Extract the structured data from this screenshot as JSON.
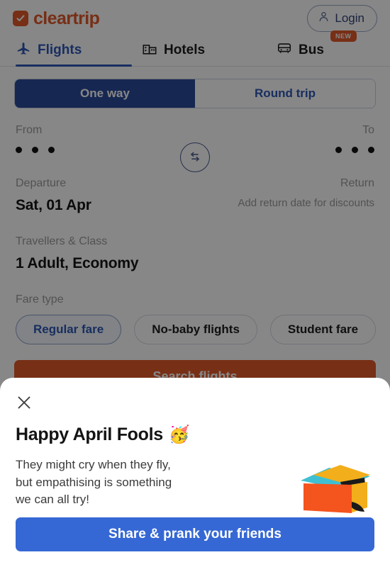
{
  "header": {
    "brand_name": "cleartrip",
    "brand_icon": "check-badge-icon",
    "login_label": "Login",
    "login_icon": "person-icon"
  },
  "tabs": [
    {
      "label": "Flights",
      "icon": "airplane-icon",
      "active": true
    },
    {
      "label": "Hotels",
      "icon": "hotel-building-icon",
      "active": false
    },
    {
      "label": "Bus",
      "icon": "bus-icon",
      "active": false,
      "badge": "NEW"
    }
  ],
  "trip_toggle": {
    "options": [
      "One way",
      "Round trip"
    ],
    "selected": "One way"
  },
  "route": {
    "from_label": "From",
    "to_label": "To",
    "from_value": "",
    "to_value": "",
    "loading": true,
    "swap_icon": "swap-arrows-icon"
  },
  "dates": {
    "departure_label": "Departure",
    "departure_value": "Sat, 01 Apr",
    "return_label": "Return",
    "return_hint": "Add return date for discounts"
  },
  "travellers": {
    "label": "Travellers & Class",
    "value": "1 Adult, Economy"
  },
  "fare": {
    "label": "Fare type",
    "chips": [
      {
        "label": "Regular fare",
        "selected": true
      },
      {
        "label": "No-baby flights",
        "selected": false
      },
      {
        "label": "Student fare",
        "selected": false
      }
    ]
  },
  "search": {
    "label": "Search flights"
  },
  "modal": {
    "close_icon": "close-icon",
    "title": "Happy April Fools",
    "emoji": "🥳",
    "body": "They might cry when they fly,\nbut empathising is something\nwe can all try!",
    "illustration": "open-box-icon",
    "cta_label": "Share & prank your friends"
  },
  "colors": {
    "brand_orange": "#e0592a",
    "primary_blue": "#2f58b5",
    "toggle_active": "#2b4a9b",
    "cta_blue": "#3568d4",
    "muted_text": "#9b9b9b"
  }
}
